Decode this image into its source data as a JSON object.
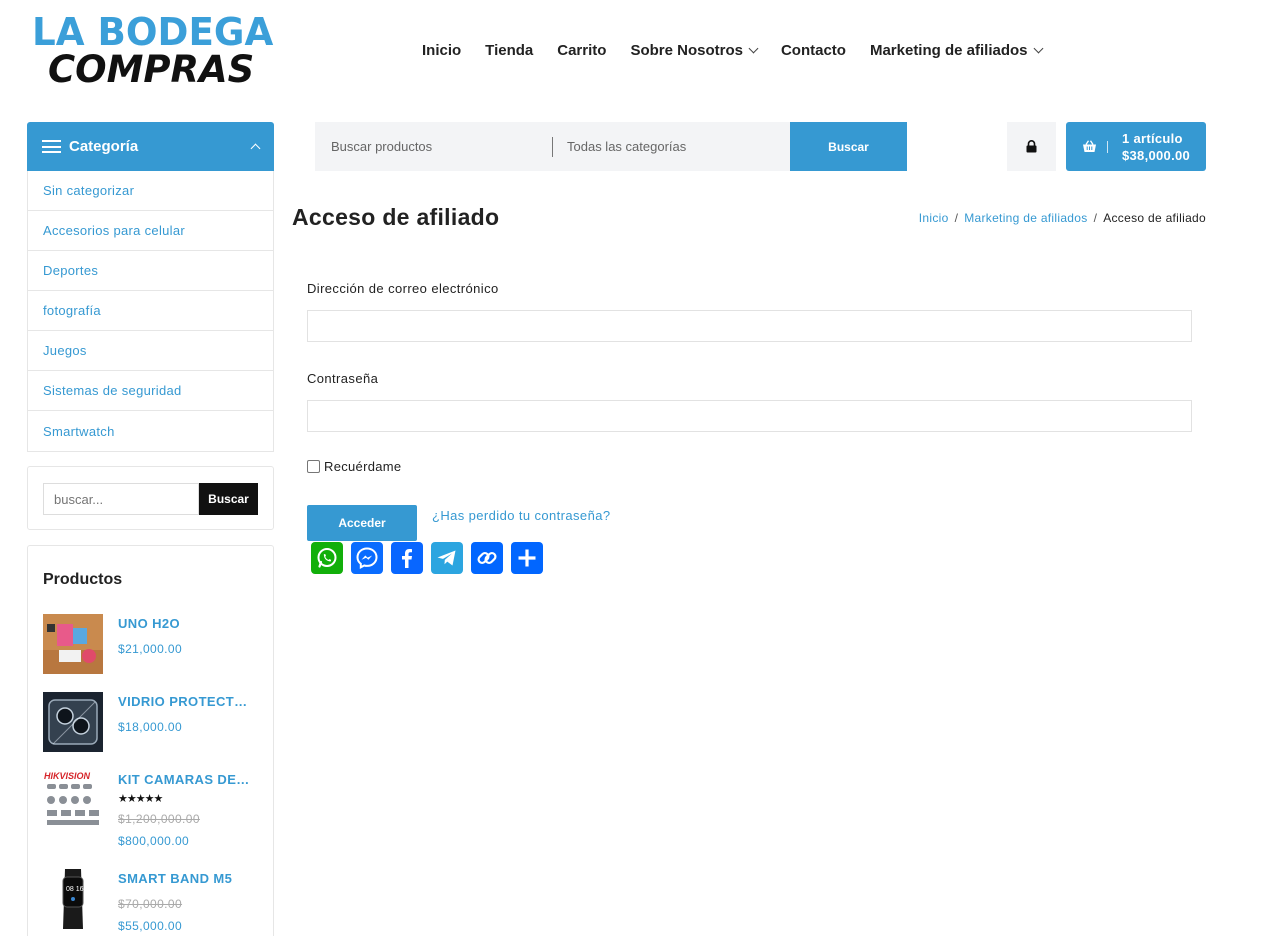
{
  "logo": {
    "line1": "LA BODEGA",
    "line2": "COMPRAS"
  },
  "nav": [
    {
      "label": "Inicio",
      "dropdown": false
    },
    {
      "label": "Tienda",
      "dropdown": false
    },
    {
      "label": "Carrito",
      "dropdown": false
    },
    {
      "label": "Sobre Nosotros",
      "dropdown": true
    },
    {
      "label": "Contacto",
      "dropdown": false
    },
    {
      "label": "Marketing de afiliados",
      "dropdown": true
    }
  ],
  "category_menu": {
    "title": "Categoría",
    "items": [
      "Sin categorizar",
      "Accesorios para celular",
      "Deportes",
      "fotografía",
      "Juegos",
      "Sistemas de seguridad",
      "Smartwatch"
    ]
  },
  "sidebar_search": {
    "placeholder": "buscar...",
    "button": "Buscar"
  },
  "products_widget": {
    "title": "Productos",
    "items": [
      {
        "name": "UNO H2O",
        "old_price": "",
        "price": "$21,000.00",
        "rating": ""
      },
      {
        "name": "VIDRIO PROTECT…",
        "old_price": "",
        "price": "$18,000.00",
        "rating": ""
      },
      {
        "name": "KIT CAMARAS DE…",
        "old_price": "$1,200,000.00",
        "price": "$800,000.00",
        "rating": "★★★★★"
      },
      {
        "name": "SMART BAND M5",
        "old_price": "$70,000.00",
        "price": "$55,000.00",
        "rating": ""
      }
    ]
  },
  "search": {
    "placeholder": "Buscar productos",
    "category": "Todas las categorías",
    "button": "Buscar"
  },
  "cart": {
    "count": "1 artículo",
    "total": "$38,000.00"
  },
  "page": {
    "title": "Acceso de afiliado"
  },
  "breadcrumb": {
    "home": "Inicio",
    "parent": "Marketing de afiliados",
    "current": "Acceso de afiliado",
    "sep": "/"
  },
  "form": {
    "email_label": "Dirección de correo electrónico",
    "email_value": "",
    "password_label": "Contraseña",
    "password_value": "",
    "remember_label": "Recuérdame",
    "remember_checked": false,
    "submit": "Acceder",
    "lost_password": "¿Has perdido tu contraseña?"
  },
  "share_buttons": [
    {
      "name": "whatsapp-icon",
      "color": "#12af0a"
    },
    {
      "name": "messenger-icon",
      "color": "#0a6cff"
    },
    {
      "name": "facebook-icon",
      "color": "#0866ff"
    },
    {
      "name": "telegram-icon",
      "color": "#2ca5e0"
    },
    {
      "name": "copy-link-icon",
      "color": "#0166ff"
    },
    {
      "name": "share-icon",
      "color": "#0166ff"
    }
  ],
  "colors": {
    "accent": "#3699d2",
    "dark": "#111111",
    "panel": "#f3f4f6"
  }
}
